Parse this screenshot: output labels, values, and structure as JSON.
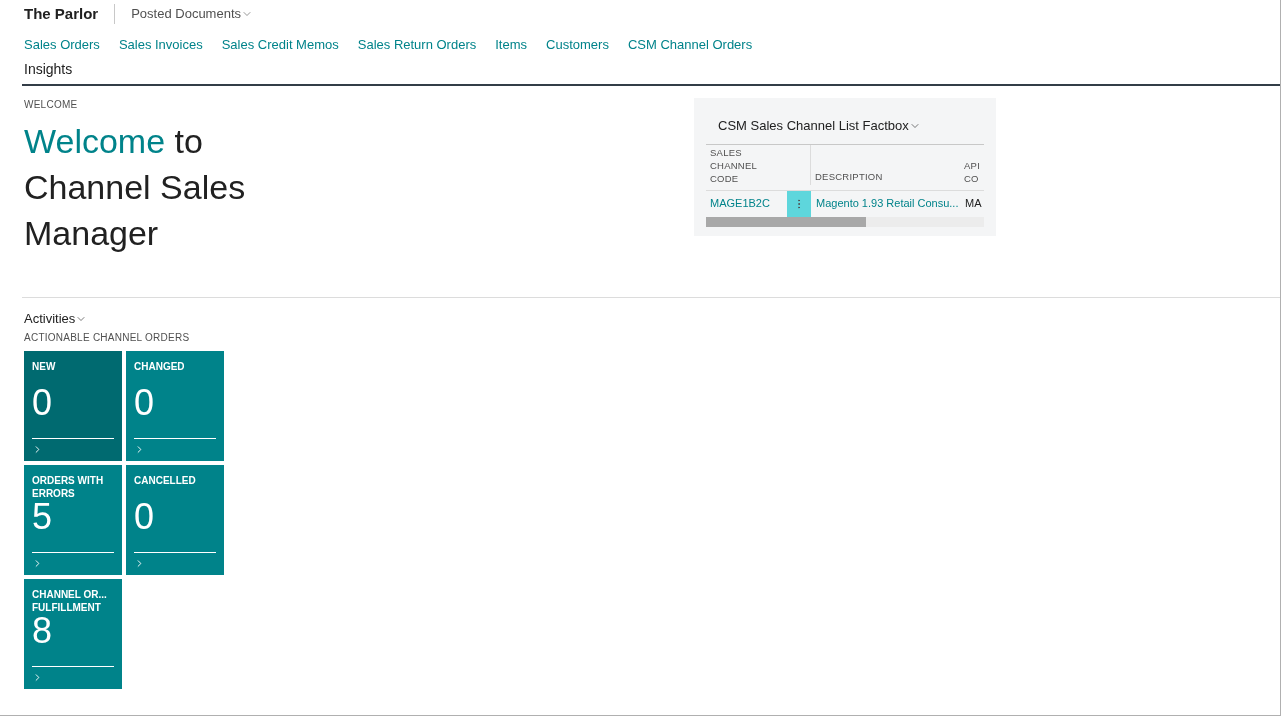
{
  "header": {
    "company": "The Parlor",
    "menu": "Posted Documents"
  },
  "nav_links": [
    "Sales Orders",
    "Sales Invoices",
    "Sales Credit Memos",
    "Sales Return Orders",
    "Items",
    "Customers",
    "CSM Channel Orders"
  ],
  "nav_links_row2": [
    "Insights"
  ],
  "welcome": {
    "caption": "WELCOME",
    "highlight": "Welcome",
    "rest": " to Channel Sales Manager"
  },
  "factbox": {
    "title": "CSM Sales Channel List Factbox",
    "columns": [
      "SALES CHANNEL CODE",
      "DESCRIPTION",
      "API CO"
    ],
    "rows": [
      {
        "code": "MAGE1B2C",
        "description": "Magento 1.93 Retail Consu...",
        "column_3": "MA"
      }
    ]
  },
  "activities": {
    "title": "Activities",
    "group": "ACTIONABLE CHANNEL ORDERS",
    "tiles": [
      {
        "label": "NEW",
        "value": "0",
        "hovered": true
      },
      {
        "label": "CHANGED",
        "value": "0",
        "hovered": false
      },
      {
        "label": "ORDERS WITH ERRORS",
        "value": "5",
        "hovered": false
      },
      {
        "label": "CANCELLED",
        "value": "0",
        "hovered": false
      },
      {
        "label": "CHANNEL OR... FULFILLMENT",
        "value": "8",
        "hovered": false
      }
    ]
  }
}
